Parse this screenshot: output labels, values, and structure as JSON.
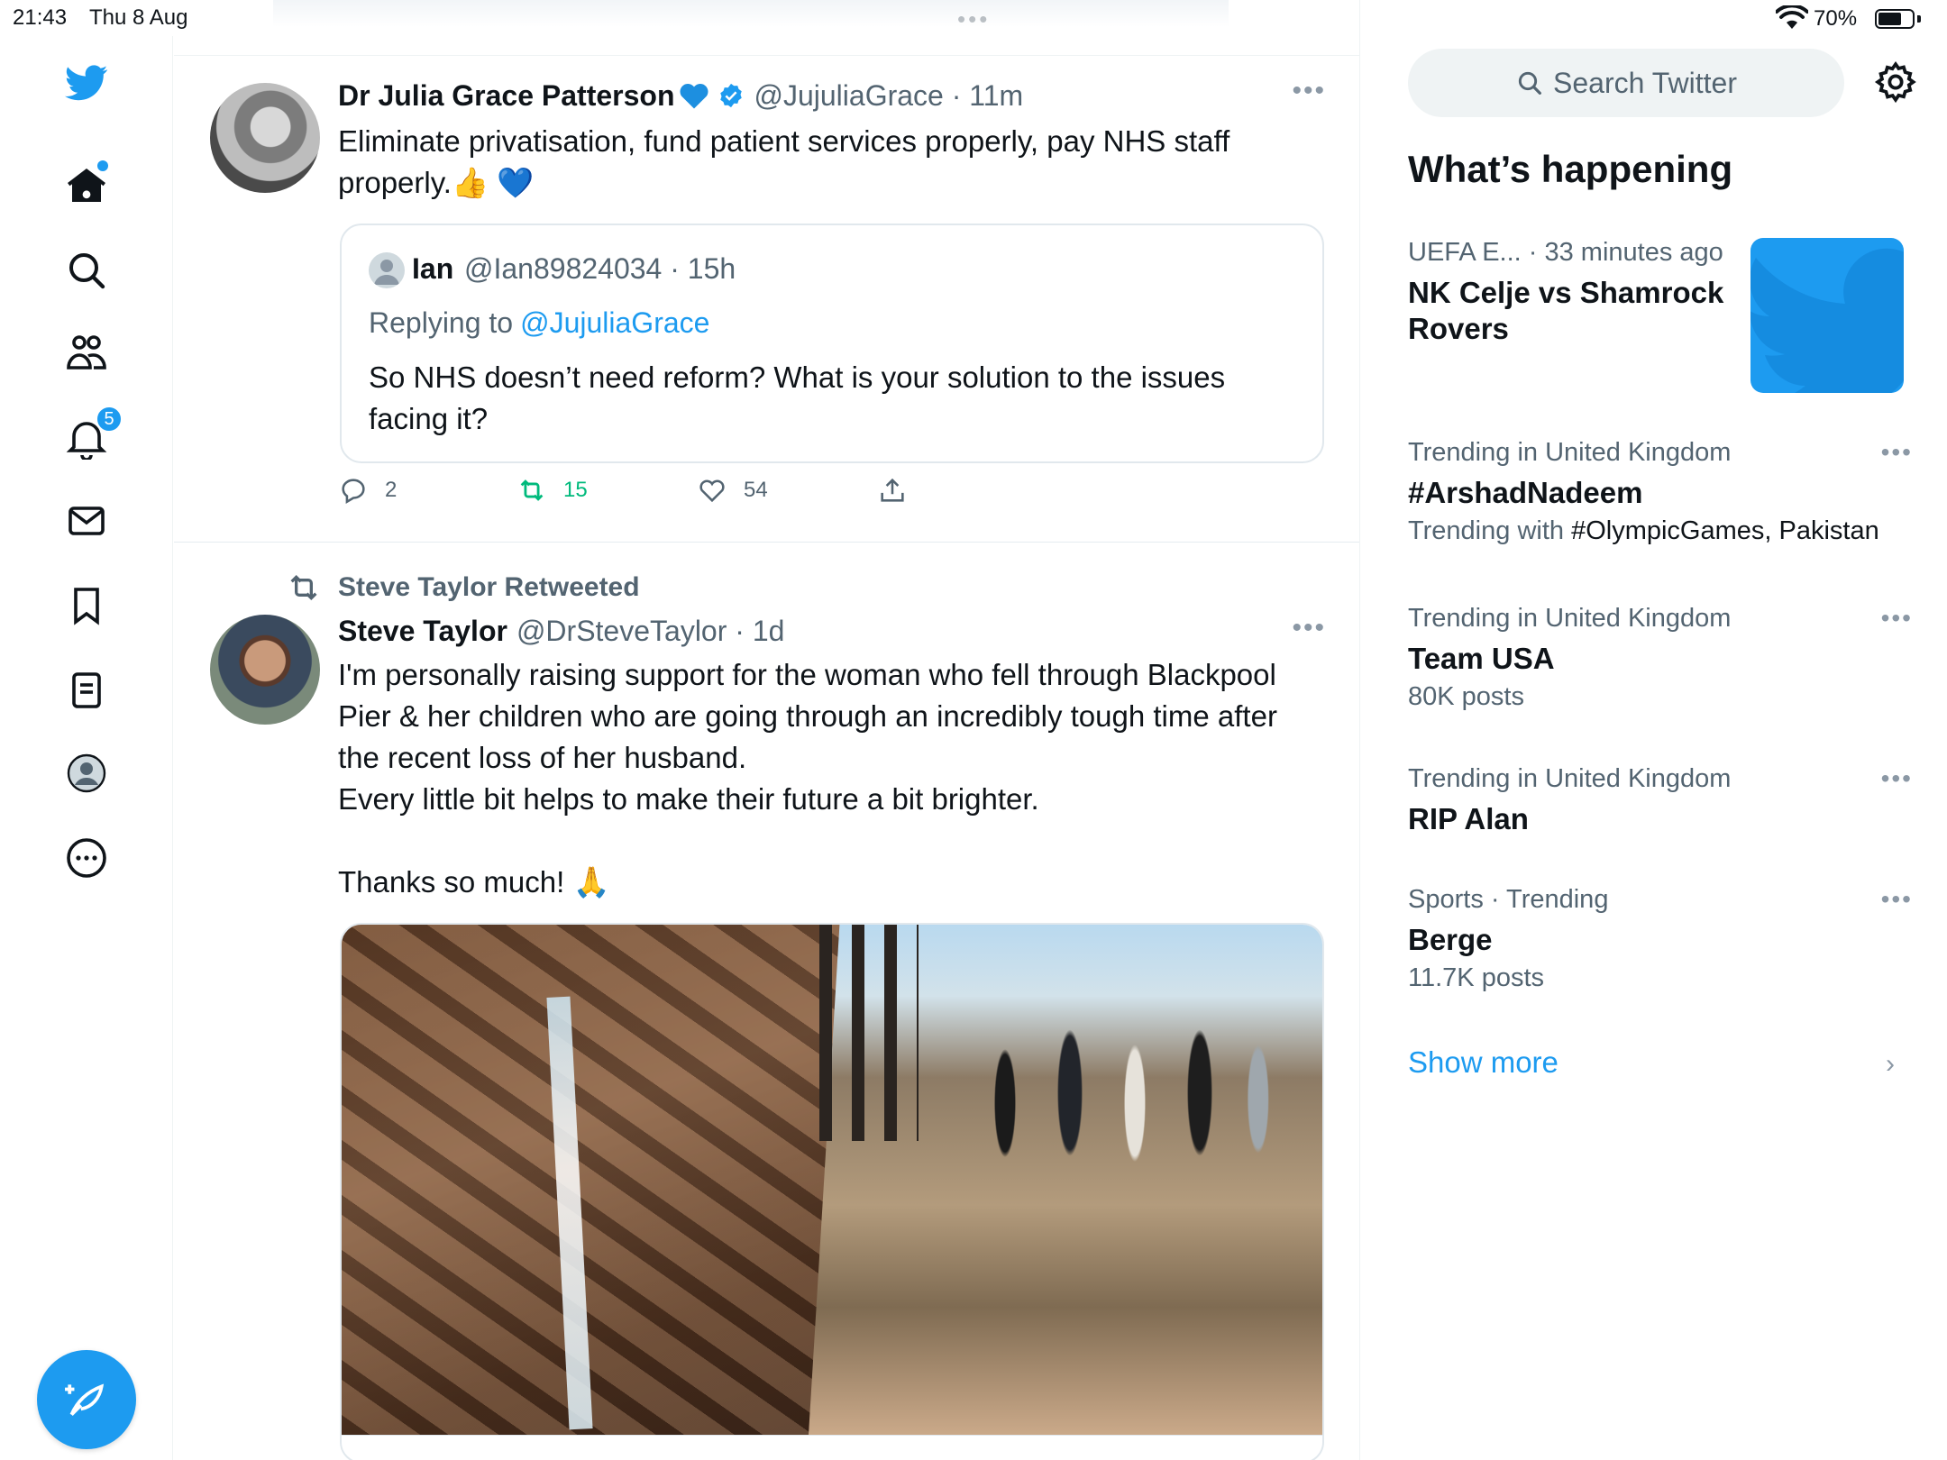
{
  "status_bar": {
    "time": "21:43",
    "date": "Thu 8 Aug",
    "battery": "70%",
    "battery_level": 0.7
  },
  "nav": {
    "notifications_badge": "5",
    "items": [
      "twitter-logo",
      "home-icon",
      "search-icon",
      "communities-icon",
      "notifications-icon",
      "messages-icon",
      "bookmarks-icon",
      "lists-icon",
      "profile-icon",
      "more-icon"
    ]
  },
  "tweets": [
    {
      "name": "Dr Julia Grace Patterson",
      "handle": "@JujuliaGrace",
      "time": "11m",
      "handle_time": "@JujuliaGrace · 11m",
      "text": "Eliminate privatisation, fund patient services properly, pay NHS staff\nproperly.",
      "text_emojis": "👍 💙",
      "quote": {
        "name": "Ian",
        "handle_time": "@Ian89824034 · 15h",
        "replying_to_prefix": "Replying to",
        "replying_to": "@JujuliaGrace",
        "text": "So NHS doesn’t need reform? What is your solution to the issues facing it?"
      },
      "replies": "2",
      "retweets": "15",
      "likes": "54"
    },
    {
      "retweeted_by": "Steve Taylor Retweeted",
      "name": "Steve Taylor",
      "handle_time": "@DrSteveTaylor · 1d",
      "text": "I'm personally raising support for the woman who fell through Blackpool Pier & her children who are going through an incredibly tough time after the recent loss of her husband.\nEvery little bit helps to make their future a bit brighter.\n\nThanks so much!",
      "text_emoji": "🙏"
    }
  ],
  "sidebar": {
    "search_placeholder": "Search Twitter",
    "title": "What’s happening",
    "trends": [
      {
        "meta": "UEFA E... · 33 minutes ago",
        "title": "NK Celje vs Shamrock Rovers"
      },
      {
        "meta": "Trending in United Kingdom",
        "title": "#ArshadNadeem",
        "sub_prefix": "Trending with",
        "sub_value": "#OlympicGames, Pakistan"
      },
      {
        "meta": "Trending in United Kingdom",
        "title": "Team USA",
        "sub": "80K posts"
      },
      {
        "meta": "Trending in United Kingdom",
        "title": "RIP Alan"
      },
      {
        "meta": "Sports · Trending",
        "title": "Berge",
        "sub": "11.7K posts"
      }
    ],
    "show_more": "Show more"
  },
  "colors": {
    "accent": "#1d9bf0",
    "retweet_green": "#00ba7c",
    "muted": "#536471"
  }
}
